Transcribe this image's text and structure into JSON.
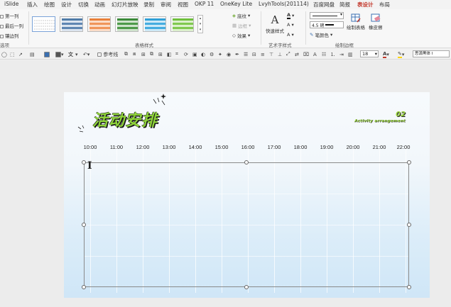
{
  "menu": {
    "tabs": [
      "iSlide",
      "插入",
      "绘图",
      "设计",
      "切换",
      "动画",
      "幻灯片放映",
      "录制",
      "审阅",
      "视图",
      "OKP 11",
      "OneKey Lite",
      "LvyhTools(201114)",
      "百度网盘",
      "简报",
      "表设计",
      "布局"
    ],
    "active_tab": "表设计"
  },
  "ribbon": {
    "options": [
      "第一列",
      "最后一列",
      "镶边列"
    ],
    "options_group_label": "选项",
    "table_styles_label": "表格样式",
    "shading_label": "底纹",
    "border_label": "边框",
    "effects_label": "效果",
    "quick_styles_label": "快速样式",
    "wordart_label": "艺术字样式",
    "pen_weight": "4.5 磅",
    "pen_color_label": "笔颜色",
    "draw_table_label": "绘制表格",
    "eraser_label": "橡皮擦",
    "draw_borders_label": "绘制边框",
    "style_colors": [
      "#ffffff",
      "#4f7ba8",
      "#e9803a",
      "#3c8a3a",
      "#2f9fd6",
      "#6fbf3c"
    ]
  },
  "toolbar": {
    "wen_label": "文",
    "reference_line_label": "参考线",
    "font_size": "18",
    "font_name": "思源黑体 I",
    "font_color": "#c0392b",
    "highlight_color": "#ffd400"
  },
  "slide": {
    "title": "活动安排",
    "number": "02",
    "subtitle": "Activity arrangement",
    "times": [
      "10:00",
      "11:00",
      "12:00",
      "13:00",
      "14:00",
      "15:00",
      "16:00",
      "17:00",
      "18:00",
      "19:00",
      "20:00",
      "21:00",
      "22:00"
    ]
  }
}
